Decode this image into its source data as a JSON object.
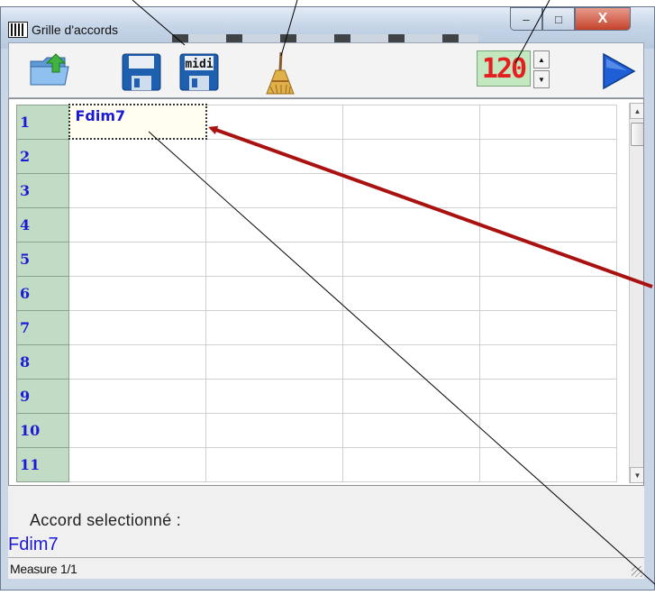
{
  "window": {
    "title": "Grille d'accords"
  },
  "title_buttons": {
    "minimize": "–",
    "maximize": "□",
    "close": "X"
  },
  "toolbar": {
    "icons": [
      "folder-open-icon",
      "save-floppy-icon",
      "midi-floppy-icon",
      "broom-icon",
      "play-icon"
    ],
    "midi_label": "midi",
    "tempo_display": "120"
  },
  "grid": {
    "rows": [
      {
        "measure": "1",
        "chords": [
          "Fdim7",
          "",
          "",
          ""
        ]
      },
      {
        "measure": "2",
        "chords": [
          "",
          "",
          "",
          ""
        ]
      },
      {
        "measure": "3",
        "chords": [
          "",
          "",
          "",
          ""
        ]
      },
      {
        "measure": "4",
        "chords": [
          "",
          "",
          "",
          ""
        ]
      },
      {
        "measure": "5",
        "chords": [
          "",
          "",
          "",
          ""
        ]
      },
      {
        "measure": "6",
        "chords": [
          "",
          "",
          "",
          ""
        ]
      },
      {
        "measure": "7",
        "chords": [
          "",
          "",
          "",
          ""
        ]
      },
      {
        "measure": "8",
        "chords": [
          "",
          "",
          "",
          ""
        ]
      },
      {
        "measure": "9",
        "chords": [
          "",
          "",
          "",
          ""
        ]
      },
      {
        "measure": "10",
        "chords": [
          "",
          "",
          "",
          ""
        ]
      },
      {
        "measure": "11",
        "chords": [
          "",
          "",
          "",
          ""
        ]
      }
    ],
    "selected": "Fdim7"
  },
  "info": {
    "label": "Accord selectionné :",
    "value": "Fdim7"
  },
  "status": {
    "text": "Measure 1/1"
  },
  "colors": {
    "accent_blue": "#1b1bd6",
    "annotation_red": "#aa1111",
    "tempo_red": "#e51f1f",
    "row_header_green": "#c1dbc4"
  }
}
